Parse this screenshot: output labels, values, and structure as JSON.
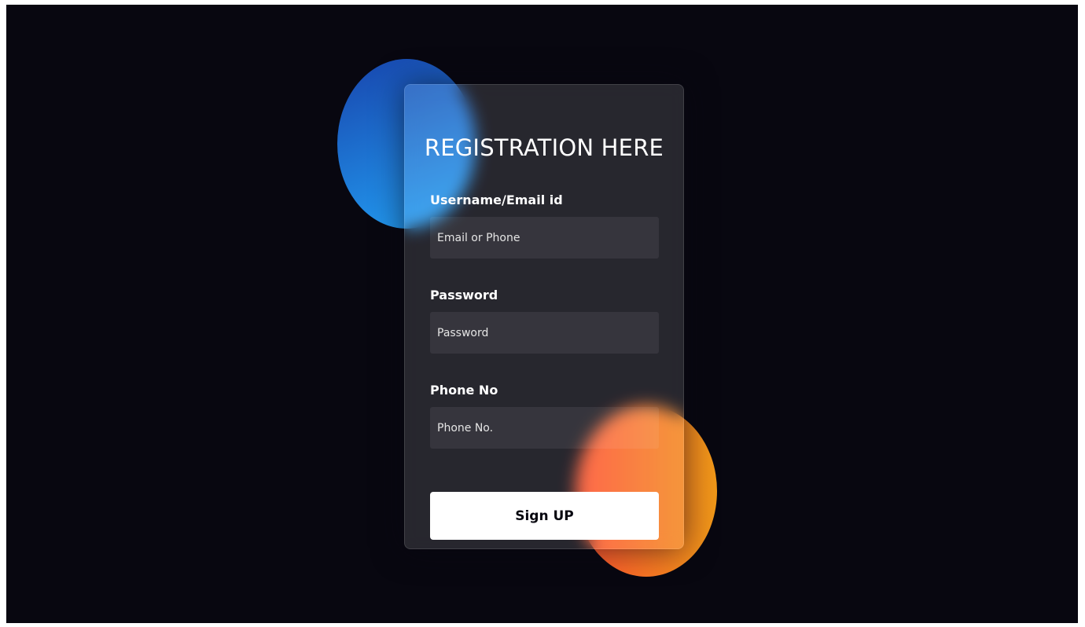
{
  "form": {
    "title": "REGISTRATION HERE",
    "fields": [
      {
        "label": "Username/Email id",
        "placeholder": "Email or Phone",
        "value": ""
      },
      {
        "label": "Password",
        "placeholder": "Password",
        "value": ""
      },
      {
        "label": "Phone No",
        "placeholder": "Phone No.",
        "value": ""
      }
    ],
    "submit_label": "Sign UP"
  },
  "colors": {
    "background": "#080710",
    "blue_shape_start": "#1845ad",
    "blue_shape_end": "#23a2f6",
    "orange_shape_start": "#ff512f",
    "orange_shape_end": "#f09819",
    "button_background": "#ffffff",
    "button_text": "#080710"
  }
}
